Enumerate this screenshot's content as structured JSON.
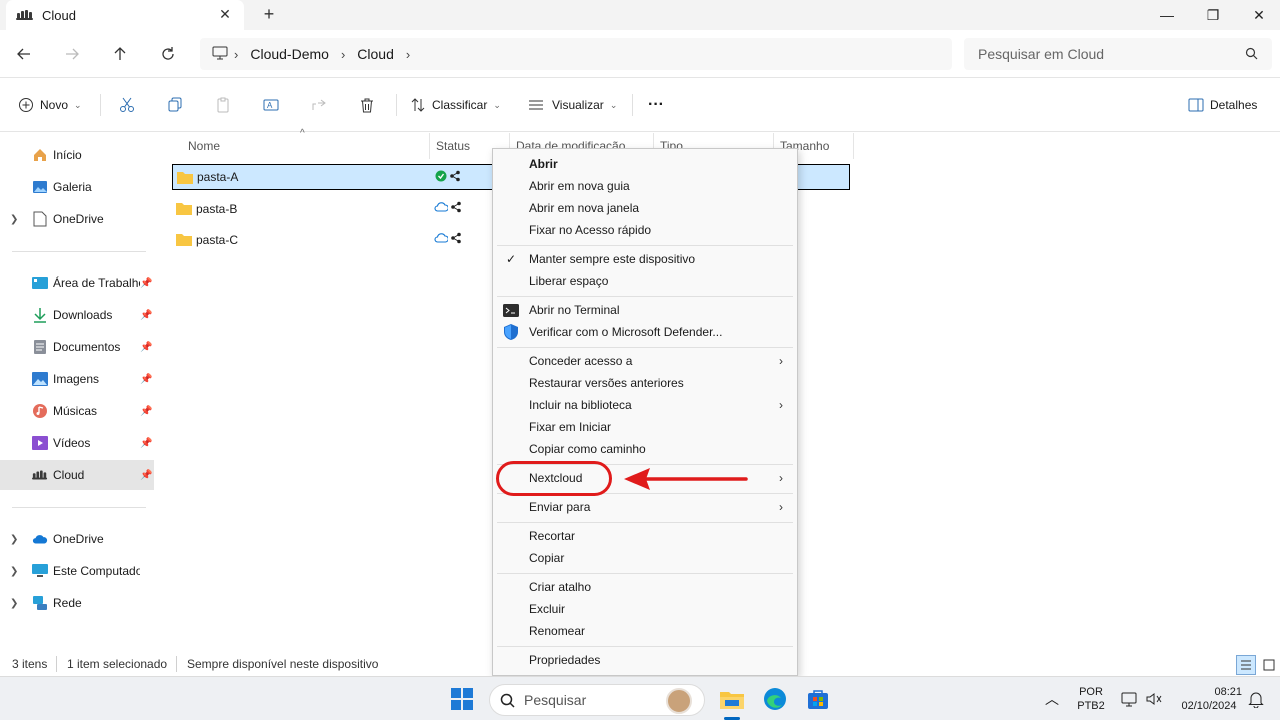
{
  "window": {
    "tab_title": "Cloud",
    "tab_close": "✕",
    "new_tab": "+",
    "minimize": "—",
    "maximize": "❐",
    "close": "✕"
  },
  "address": {
    "crumbs": [
      "Cloud-Demo",
      "Cloud"
    ],
    "separator": "›"
  },
  "search": {
    "placeholder": "Pesquisar em Cloud"
  },
  "toolbar": {
    "new_label": "Novo",
    "sort_label": "Classificar",
    "view_label": "Visualizar",
    "more_label": "···",
    "details_label": "Detalhes"
  },
  "sidebar": {
    "items": [
      {
        "label": "Início",
        "icon": "home-icon"
      },
      {
        "label": "Galeria",
        "icon": "gallery-icon"
      },
      {
        "label": "OneDrive",
        "icon": "document-icon"
      },
      {
        "label": "Área de Trabalho",
        "icon": "desktop-icon"
      },
      {
        "label": "Downloads",
        "icon": "download-icon"
      },
      {
        "label": "Documentos",
        "icon": "documents-icon"
      },
      {
        "label": "Imagens",
        "icon": "images-icon"
      },
      {
        "label": "Músicas",
        "icon": "music-icon"
      },
      {
        "label": "Vídeos",
        "icon": "video-icon"
      },
      {
        "label": "Cloud",
        "icon": "cloud-app-icon"
      },
      {
        "label": "OneDrive",
        "icon": "onedrive-icon"
      },
      {
        "label": "Este Computador",
        "icon": "computer-icon"
      },
      {
        "label": "Rede",
        "icon": "network-icon"
      }
    ]
  },
  "columns": {
    "name": "Nome",
    "status": "Status",
    "modified": "Data de modificação",
    "type": "Tipo",
    "size": "Tamanho"
  },
  "files": [
    {
      "name": "pasta-A",
      "status": "synced"
    },
    {
      "name": "pasta-B",
      "status": "cloud"
    },
    {
      "name": "pasta-C",
      "status": "cloud"
    }
  ],
  "statusbar": {
    "count": "3 itens",
    "selected": "1 item selecionado",
    "availability": "Sempre disponível neste dispositivo"
  },
  "context_menu": {
    "open": "Abrir",
    "open_new_tab": "Abrir em nova guia",
    "open_new_window": "Abrir em nova janela",
    "pin_quick_access": "Fixar no Acesso rápido",
    "keep_on_device": "Manter sempre este dispositivo",
    "free_space": "Liberar espaço",
    "open_terminal": "Abrir no Terminal",
    "defender_scan": "Verificar com o Microsoft Defender...",
    "give_access": "Conceder acesso a",
    "restore_versions": "Restaurar versões anteriores",
    "include_library": "Incluir na biblioteca",
    "pin_start": "Fixar em Iniciar",
    "copy_path": "Copiar como caminho",
    "nextcloud": "Nextcloud",
    "send_to": "Enviar para",
    "cut": "Recortar",
    "copy": "Copiar",
    "create_shortcut": "Criar atalho",
    "delete": "Excluir",
    "rename": "Renomear",
    "properties": "Propriedades",
    "checkmark": "✓",
    "submenu_chevron": "›"
  },
  "taskbar": {
    "search_placeholder": "Pesquisar",
    "lang_top": "POR",
    "lang_bottom": "PTB2",
    "time": "08:21",
    "date": "02/10/2024"
  },
  "colors": {
    "selection": "#cce8ff",
    "annotation": "#e01b1b",
    "accent": "#0067c0",
    "folder": "#f8c642"
  }
}
